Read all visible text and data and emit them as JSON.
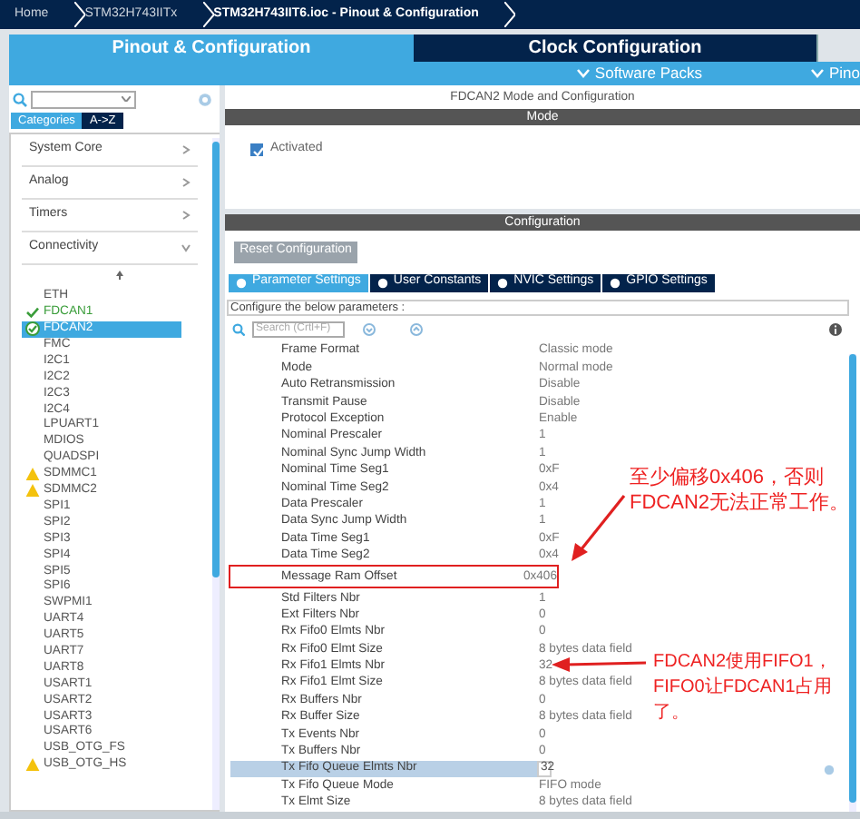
{
  "breadcrumb": [
    "Home",
    "STM32H743IITx",
    "STM32H743IIT6.ioc - Pinout & Configuration"
  ],
  "main_tabs": [
    {
      "label": "Pinout & Configuration",
      "selected": true
    },
    {
      "label": "Clock Configuration",
      "selected": false
    }
  ],
  "sub_bar": [
    "Software Packs",
    "Pino"
  ],
  "left": {
    "category_tabs": [
      {
        "label": "Categories",
        "selected": true
      },
      {
        "label": "A->Z",
        "selected": false
      }
    ],
    "categories": [
      {
        "label": "System Core",
        "expanded": false
      },
      {
        "label": "Analog",
        "expanded": false
      },
      {
        "label": "Timers",
        "expanded": false
      },
      {
        "label": "Connectivity",
        "expanded": true
      }
    ],
    "peripherals": [
      {
        "label": "ETH",
        "selected": false,
        "kind": "plain"
      },
      {
        "label": "FDCAN1",
        "selected": false,
        "kind": "enabled"
      },
      {
        "label": "FDCAN2",
        "selected": true,
        "kind": "enabled"
      },
      {
        "label": "FMC",
        "selected": false,
        "kind": "plain"
      },
      {
        "label": "I2C1",
        "selected": false,
        "kind": "plain"
      },
      {
        "label": "I2C2",
        "selected": false,
        "kind": "plain"
      },
      {
        "label": "I2C3",
        "selected": false,
        "kind": "plain"
      },
      {
        "label": "I2C4",
        "selected": false,
        "kind": "plain"
      },
      {
        "label": "LPUART1",
        "selected": false,
        "kind": "plain"
      },
      {
        "label": "MDIOS",
        "selected": false,
        "kind": "plain"
      },
      {
        "label": "QUADSPI",
        "selected": false,
        "kind": "plain"
      },
      {
        "label": "SDMMC1",
        "selected": false,
        "kind": "warning"
      },
      {
        "label": "SDMMC2",
        "selected": false,
        "kind": "warning"
      },
      {
        "label": "SPI1",
        "selected": false,
        "kind": "plain"
      },
      {
        "label": "SPI2",
        "selected": false,
        "kind": "plain"
      },
      {
        "label": "SPI3",
        "selected": false,
        "kind": "plain"
      },
      {
        "label": "SPI4",
        "selected": false,
        "kind": "plain"
      },
      {
        "label": "SPI5",
        "selected": false,
        "kind": "plain"
      },
      {
        "label": "SPI6",
        "selected": false,
        "kind": "plain"
      },
      {
        "label": "SWPMI1",
        "selected": false,
        "kind": "plain"
      },
      {
        "label": "UART4",
        "selected": false,
        "kind": "plain"
      },
      {
        "label": "UART5",
        "selected": false,
        "kind": "plain"
      },
      {
        "label": "UART7",
        "selected": false,
        "kind": "plain"
      },
      {
        "label": "UART8",
        "selected": false,
        "kind": "plain"
      },
      {
        "label": "USART1",
        "selected": false,
        "kind": "plain"
      },
      {
        "label": "USART2",
        "selected": false,
        "kind": "plain"
      },
      {
        "label": "USART3",
        "selected": false,
        "kind": "plain"
      },
      {
        "label": "USART6",
        "selected": false,
        "kind": "plain"
      },
      {
        "label": "USB_OTG_FS",
        "selected": false,
        "kind": "plain"
      },
      {
        "label": "USB_OTG_HS",
        "selected": false,
        "kind": "warning"
      }
    ]
  },
  "right": {
    "title": "FDCAN2 Mode and Configuration",
    "mode_header": "Mode",
    "activated": {
      "label": "Activated",
      "checked": true
    },
    "config_header": "Configuration",
    "reset_button": "Reset Configuration",
    "config_tabs": [
      {
        "label": "Parameter Settings",
        "selected": true
      },
      {
        "label": "User Constants",
        "selected": false
      },
      {
        "label": "NVIC Settings",
        "selected": false
      },
      {
        "label": "GPIO Settings",
        "selected": false
      }
    ],
    "hint": "Configure the below parameters :",
    "search": {
      "placeholder": "Search (Crtl+F)"
    },
    "params": [
      {
        "name": "Frame Format",
        "value": "Classic mode",
        "selected": false,
        "highlighted": false
      },
      {
        "name": "Mode",
        "value": "Normal mode",
        "selected": false,
        "highlighted": false
      },
      {
        "name": "Auto Retransmission",
        "value": "Disable",
        "selected": false,
        "highlighted": false
      },
      {
        "name": "Transmit Pause",
        "value": "Disable",
        "selected": false,
        "highlighted": false
      },
      {
        "name": "Protocol Exception",
        "value": "Enable",
        "selected": false,
        "highlighted": false
      },
      {
        "name": "Nominal Prescaler",
        "value": "1",
        "selected": false,
        "highlighted": false
      },
      {
        "name": "Nominal Sync Jump Width",
        "value": "1",
        "selected": false,
        "highlighted": false
      },
      {
        "name": "Nominal Time Seg1",
        "value": "0xF",
        "selected": false,
        "highlighted": false
      },
      {
        "name": "Nominal Time Seg2",
        "value": "0x4",
        "selected": false,
        "highlighted": false
      },
      {
        "name": "Data Prescaler",
        "value": "1",
        "selected": false,
        "highlighted": false
      },
      {
        "name": "Data Sync Jump Width",
        "value": "1",
        "selected": false,
        "highlighted": false
      },
      {
        "name": "Data Time Seg1",
        "value": "0xF",
        "selected": false,
        "highlighted": false
      },
      {
        "name": "Data Time Seg2",
        "value": "0x4",
        "selected": false,
        "highlighted": false
      },
      {
        "name": "Message Ram Offset",
        "value": "0x406",
        "selected": false,
        "highlighted": true
      },
      {
        "name": "Std Filters Nbr",
        "value": "1",
        "selected": false,
        "highlighted": false
      },
      {
        "name": "Ext Filters Nbr",
        "value": "0",
        "selected": false,
        "highlighted": false
      },
      {
        "name": "Rx Fifo0 Elmts Nbr",
        "value": "0",
        "selected": false,
        "highlighted": false
      },
      {
        "name": "Rx Fifo0 Elmt Size",
        "value": "8 bytes data field",
        "selected": false,
        "highlighted": false
      },
      {
        "name": "Rx Fifo1 Elmts Nbr",
        "value": "32",
        "selected": false,
        "highlighted": false
      },
      {
        "name": "Rx Fifo1 Elmt Size",
        "value": "8 bytes data field",
        "selected": false,
        "highlighted": false
      },
      {
        "name": "Rx Buffers Nbr",
        "value": "0",
        "selected": false,
        "highlighted": false
      },
      {
        "name": "Rx Buffer Size",
        "value": "8 bytes data field",
        "selected": false,
        "highlighted": false
      },
      {
        "name": "Tx Events Nbr",
        "value": "0",
        "selected": false,
        "highlighted": false
      },
      {
        "name": "Tx Buffers Nbr",
        "value": "0",
        "selected": false,
        "highlighted": false
      },
      {
        "name": "Tx Fifo Queue Elmts Nbr",
        "value": "32",
        "selected": true,
        "highlighted": false
      },
      {
        "name": "Tx Fifo Queue Mode",
        "value": "FIFO mode",
        "selected": false,
        "highlighted": false
      },
      {
        "name": "Tx Elmt Size",
        "value": "8 bytes data field",
        "selected": false,
        "highlighted": false
      }
    ]
  },
  "annotations": [
    {
      "lines": [
        "至少偏移0x406，否则",
        "FDCAN2无法正常工作。"
      ]
    },
    {
      "lines": [
        "FDCAN2使用FIFO1，",
        "FIFO0让FDCAN1占用",
        "了。"
      ]
    }
  ]
}
